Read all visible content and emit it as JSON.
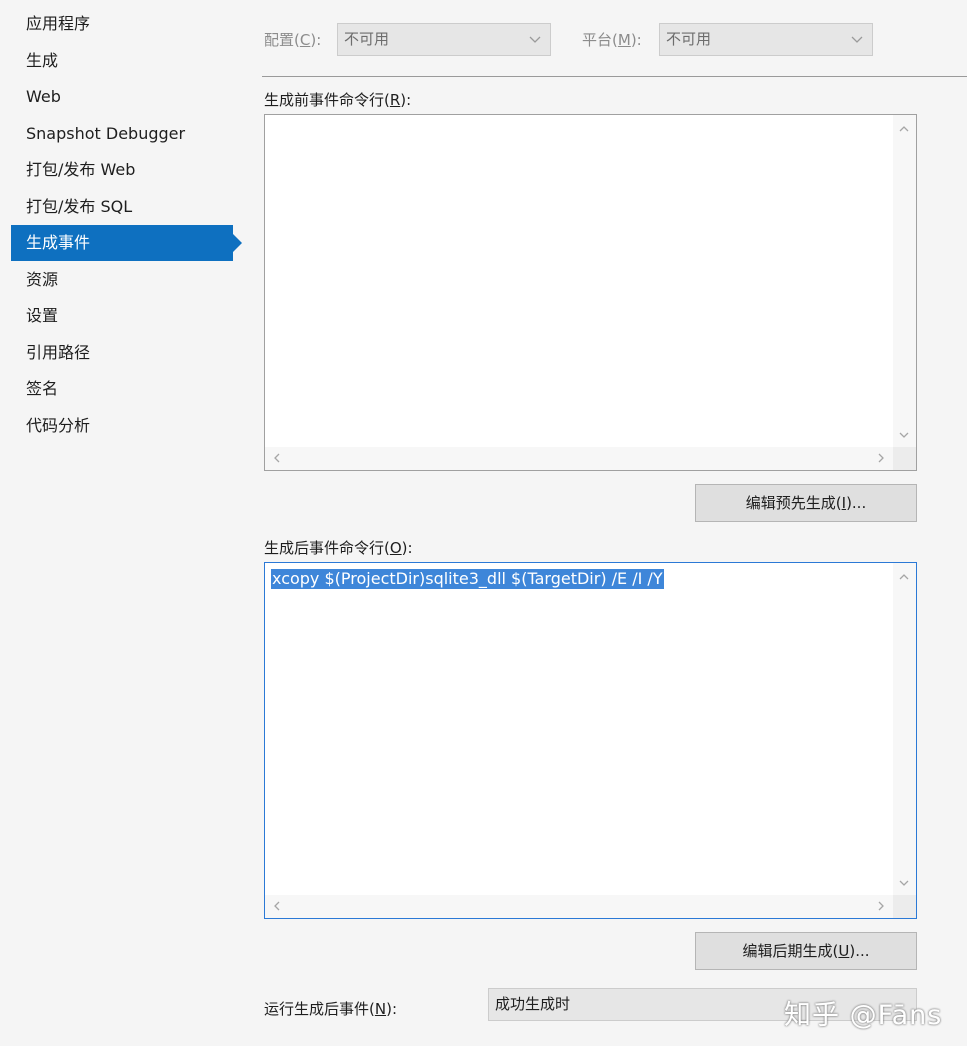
{
  "sidebar": {
    "items": [
      {
        "label": "应用程序"
      },
      {
        "label": "生成"
      },
      {
        "label": "Web"
      },
      {
        "label": "Snapshot Debugger"
      },
      {
        "label": "打包/发布 Web"
      },
      {
        "label": "打包/发布 SQL"
      },
      {
        "label": "生成事件",
        "active": true
      },
      {
        "label": "资源"
      },
      {
        "label": "设置"
      },
      {
        "label": "引用路径"
      },
      {
        "label": "签名"
      },
      {
        "label": "代码分析"
      }
    ]
  },
  "config": {
    "label_pre": "配置(",
    "label_key": "C",
    "label_post": "):",
    "value": "不可用"
  },
  "platform": {
    "label_pre": "平台(",
    "label_key": "M",
    "label_post": "):",
    "value": "不可用"
  },
  "pre_build": {
    "label_pre": "生成前事件命令行(",
    "label_key": "R",
    "label_post": "):",
    "value": "",
    "button_pre": "编辑预先生成(",
    "button_key": "I",
    "button_post": ")..."
  },
  "post_build": {
    "label_pre": "生成后事件命令行(",
    "label_key": "O",
    "label_post": "):",
    "value": "xcopy $(ProjectDir)sqlite3_dll $(TargetDir) /E /I /Y",
    "button_pre": "编辑后期生成(",
    "button_key": "U",
    "button_post": ")..."
  },
  "run_post_build": {
    "label_pre": "运行生成后事件(",
    "label_key": "N",
    "label_post": "):",
    "value": "成功生成时"
  },
  "watermark": "知乎 @Fāns",
  "colors": {
    "accent": "#0e70c0",
    "selection": "#3e86d9",
    "panel_bg": "#f5f5f5"
  }
}
